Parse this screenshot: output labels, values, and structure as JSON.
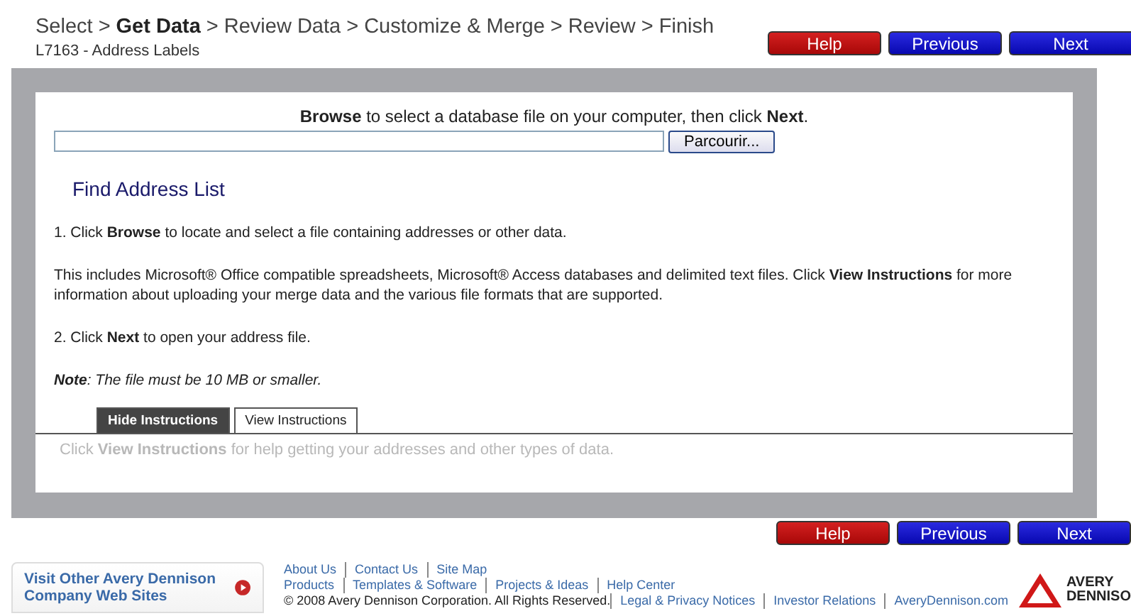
{
  "breadcrumb": [
    {
      "label": "Select",
      "selected": false
    },
    {
      "label": "Get Data",
      "selected": true
    },
    {
      "label": "Review Data",
      "selected": false
    },
    {
      "label": "Customize & Merge",
      "selected": false
    },
    {
      "label": "Review",
      "selected": false
    },
    {
      "label": "Finish",
      "selected": false
    }
  ],
  "separator": ">",
  "subtitle": "L7163 - Address Labels",
  "nav_buttons": [
    {
      "label": "Help",
      "kind": "help"
    },
    {
      "label": "Previous",
      "kind": "nav"
    },
    {
      "label": "Next",
      "kind": "nav"
    }
  ],
  "browse": {
    "prompt": "**Browse** to select a database file on your computer, then click **Next**.",
    "button": "Parcourir..."
  },
  "section_title": "Find Address List",
  "instructions": [
    {
      "text": "1. Click **Browse** to locate and select a file containing addresses or other data.",
      "kind": "plain"
    },
    {
      "text": "This includes Microsoft® Office compatible spreadsheets, Microsoft® Access databases and delimited text files. Click **View Instructions** for more information about uploading your merge data and the various file formats that are supported.",
      "kind": "plain"
    },
    {
      "text": "2. Click **Next** to open your address file.",
      "kind": "plain"
    },
    {
      "text": "**Note**: The file must be 10 MB or smaller.",
      "kind": "note"
    }
  ],
  "tabs": [
    {
      "label": "Hide Instructions",
      "selected": true
    },
    {
      "label": "View Instructions",
      "selected": false
    }
  ],
  "tab_hint": "Click **View Instructions** for help getting your addresses and other types of data.",
  "bottom_buttons": [
    {
      "label": "Help",
      "kind": "help"
    },
    {
      "label": "Previous",
      "kind": "nav"
    },
    {
      "label": "Next",
      "kind": "nav"
    }
  ],
  "footer": {
    "visit": "Visit Other Avery Dennison Company Web Sites",
    "link_rows": [
      [
        "About Us",
        "Contact Us",
        "Site Map"
      ],
      [
        "Products",
        "Templates & Software",
        "Projects & Ideas",
        "Help Center"
      ]
    ],
    "copyright": "© 2008 Avery Dennison Corporation. All Rights Reserved.",
    "legal_links": [
      "Legal & Privacy Notices",
      "Investor Relations",
      "AveryDennison.com"
    ],
    "logo_lines": [
      "AVERY",
      "DENNISO"
    ]
  }
}
